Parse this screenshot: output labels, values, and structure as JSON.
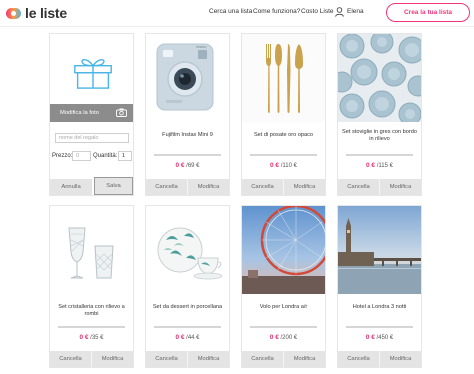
{
  "header": {
    "logo_text": "le liste",
    "nav": [
      "Cerca una lista",
      "Come funziona?",
      "Costo Liste"
    ],
    "user_name": "Elena",
    "cta_label": "Crea la tua lista"
  },
  "edit_card": {
    "photo_label": "Modifica la foto",
    "name_placeholder": "nome del regalo",
    "price_label": "Prezzo:",
    "price_value": "0",
    "quantity_label": "Quantità:",
    "quantity_value": "1",
    "cancel_label": "Annulla",
    "save_label": "Salva"
  },
  "gifts": [
    {
      "title": "Fujifilm Instax Mini 9",
      "current": "0 €",
      "total": "/69 €",
      "progress": 0
    },
    {
      "title": "Set di posate oro opaco",
      "current": "0 €",
      "total": "/110 €",
      "progress": 0
    },
    {
      "title": "Set stoviglie in gres con bordo in rilievo",
      "current": "0 €",
      "total": "/115 €",
      "progress": 0
    },
    {
      "title": "Set cristalleria con rilievo a rombi",
      "current": "0 €",
      "total": "/35 €",
      "progress": 0
    },
    {
      "title": "Set da dessert in porcellana",
      "current": "0 €",
      "total": "/44 €",
      "progress": 0
    },
    {
      "title": "Volo per Londra a/r",
      "current": "0 €",
      "total": "/200 €",
      "progress": 0
    },
    {
      "title": "Hotel a Londra 3 notti",
      "current": "0 €",
      "total": "/450 €",
      "progress": 0
    }
  ],
  "card_actions": {
    "cancel": "Cancella",
    "edit": "Modifica"
  },
  "colors": {
    "accent": "#f2357a",
    "price": "#e8336f",
    "button_bg": "#e4e4e4"
  }
}
